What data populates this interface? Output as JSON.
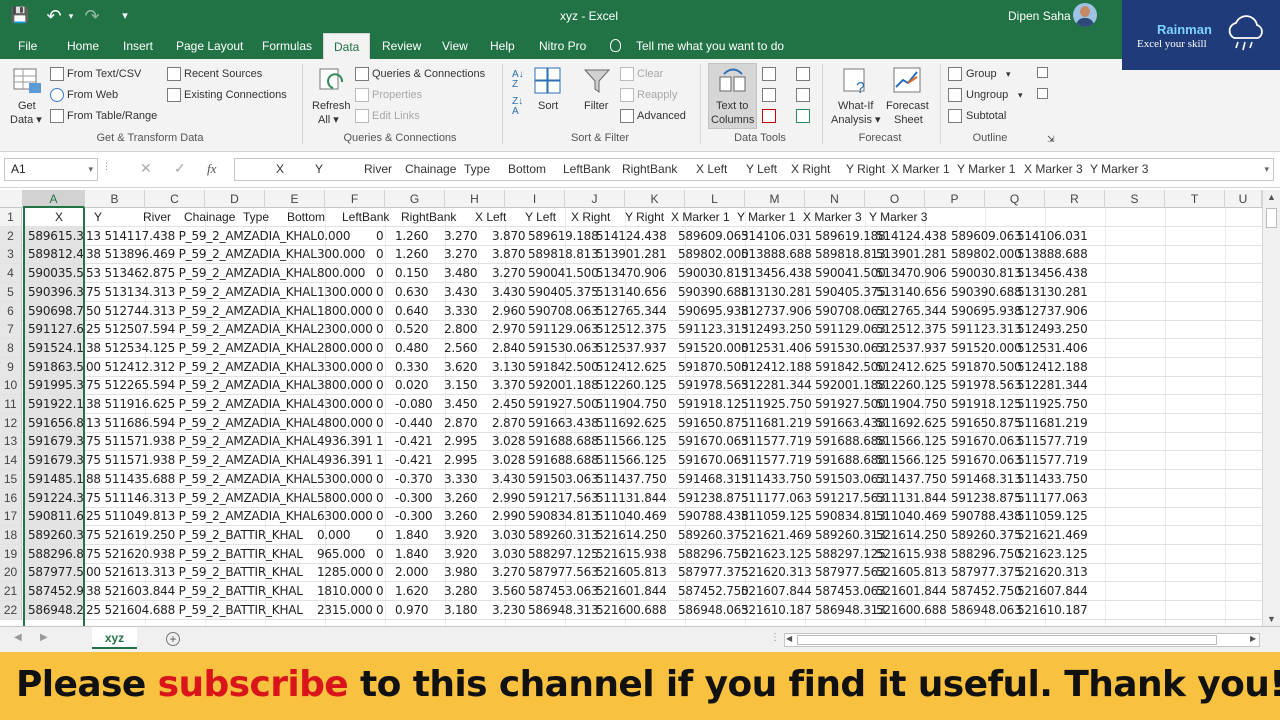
{
  "window": {
    "title": "xyz  -  Excel",
    "user": "Dipen Saha"
  },
  "brand": {
    "name": "Rainman",
    "tagline": "Excel your skill"
  },
  "qat": {
    "save": "💾",
    "undo": "↶",
    "redo": "↷",
    "more": "▾"
  },
  "tabs": [
    "File",
    "Home",
    "Insert",
    "Page Layout",
    "Formulas",
    "Data",
    "Review",
    "View",
    "Help",
    "Nitro Pro"
  ],
  "active_tab": "Data",
  "tell_me": "Tell me what you want to do",
  "ribbon": {
    "get_data": "Get",
    "get_data2": "Data ▾",
    "from_text": "From Text/CSV",
    "from_web": "From Web",
    "from_table": "From Table/Range",
    "recent_sources": "Recent Sources",
    "existing_connections": "Existing Connections",
    "refresh_all": "Refresh",
    "refresh_all2": "All ▾",
    "queries_connections": "Queries & Connections",
    "properties": "Properties",
    "edit_links": "Edit Links",
    "sort": "Sort",
    "filter": "Filter",
    "clear": "Clear",
    "reapply": "Reapply",
    "advanced": "Advanced",
    "text_to_columns": "Text to",
    "text_to_columns2": "Columns",
    "what_if": "What-If",
    "what_if2": "Analysis ▾",
    "forecast_sheet": "Forecast",
    "forecast_sheet2": "Sheet",
    "group": "Group",
    "ungroup": "Ungroup",
    "subtotal": "Subtotal",
    "groups": {
      "get_transform": "Get & Transform Data",
      "queries": "Queries & Connections",
      "sort_filter": "Sort & Filter",
      "data_tools": "Data Tools",
      "forecast": "Forecast",
      "outline": "Outline"
    }
  },
  "formula_bar": {
    "name_box": "A1",
    "fx": "fx",
    "content": [
      "X",
      "Y",
      "River",
      "Chainage",
      "Type",
      "Bottom",
      "LeftBank",
      "RightBank",
      "X Left",
      "Y Left",
      "X Right",
      "Y Right",
      "X Marker 1",
      "Y Marker 1",
      "X Marker 3",
      "Y Marker 3"
    ]
  },
  "columns": [
    "A",
    "B",
    "C",
    "D",
    "E",
    "F",
    "G",
    "H",
    "I",
    "J",
    "K",
    "L",
    "M",
    "N",
    "O",
    "P",
    "Q",
    "R",
    "S",
    "T",
    "U"
  ],
  "sheet": {
    "header_row": [
      "X",
      "Y",
      "River",
      "Chainage",
      "Type",
      "Bottom",
      "LeftBank",
      "RightBank",
      "X Left",
      "Y Left",
      "X Right",
      "Y Right",
      "X Marker 1",
      "Y Marker 1",
      "X Marker 3",
      "Y Marker 3"
    ],
    "rows": [
      {
        "n": "2",
        "a": "589615.3",
        "b": "13 514117.438 P_59_2_AMZADIA_KHAL",
        "c": "0.000",
        "d": "0",
        "e": "1.260",
        "f": "3.270",
        "g": "3.870",
        "h": "589619.188",
        "i": "514124.438",
        "j": "589609.063",
        "k": "514106.031",
        "l": "589619.188",
        "m": "514124.438",
        "o": "589609.063",
        "p": "514106.031"
      },
      {
        "n": "3",
        "a": "589812.4",
        "b": "38 513896.469 P_59_2_AMZADIA_KHAL",
        "c": "300.000",
        "d": "0",
        "e": "1.260",
        "f": "3.270",
        "g": "3.870",
        "h": "589818.813",
        "i": "513901.281",
        "j": "589802.000",
        "k": "513888.688",
        "l": "589818.813",
        "m": "513901.281",
        "o": "589802.000",
        "p": "513888.688"
      },
      {
        "n": "4",
        "a": "590035.5",
        "b": "53 513462.875 P_59_2_AMZADIA_KHAL",
        "c": "800.000",
        "d": "0",
        "e": "0.150",
        "f": "3.480",
        "g": "3.270",
        "h": "590041.500",
        "i": "513470.906",
        "j": "590030.813",
        "k": "513456.438",
        "l": "590041.500",
        "m": "513470.906",
        "o": "590030.813",
        "p": "513456.438"
      },
      {
        "n": "5",
        "a": "590396.3",
        "b": "75 513134.313 P_59_2_AMZADIA_KHAL",
        "c": "1300.000",
        "d": "0",
        "e": "0.630",
        "f": "3.430",
        "g": "3.430",
        "h": "590405.375",
        "i": "513140.656",
        "j": "590390.688",
        "k": "513130.281",
        "l": "590405.375",
        "m": "513140.656",
        "o": "590390.688",
        "p": "513130.281"
      },
      {
        "n": "6",
        "a": "590698.7",
        "b": "50 512744.313 P_59_2_AMZADIA_KHAL",
        "c": "1800.000",
        "d": "0",
        "e": "0.640",
        "f": "3.330",
        "g": "2.960",
        "h": "590708.063",
        "i": "512765.344",
        "j": "590695.938",
        "k": "512737.906",
        "l": "590708.063",
        "m": "512765.344",
        "o": "590695.938",
        "p": "512737.906"
      },
      {
        "n": "7",
        "a": "591127.6",
        "b": "25 512507.594 P_59_2_AMZADIA_KHAL",
        "c": "2300.000",
        "d": "0",
        "e": "0.520",
        "f": "2.800",
        "g": "2.970",
        "h": "591129.063",
        "i": "512512.375",
        "j": "591123.313",
        "k": "512493.250",
        "l": "591129.063",
        "m": "512512.375",
        "o": "591123.313",
        "p": "512493.250"
      },
      {
        "n": "8",
        "a": "591524.1",
        "b": "38 512534.125 P_59_2_AMZADIA_KHAL",
        "c": "2800.000",
        "d": "0",
        "e": "0.480",
        "f": "2.560",
        "g": "2.840",
        "h": "591530.063",
        "i": "512537.937",
        "j": "591520.000",
        "k": "512531.406",
        "l": "591530.063",
        "m": "512537.937",
        "o": "591520.000",
        "p": "512531.406"
      },
      {
        "n": "9",
        "a": "591863.5",
        "b": "00 512412.312 P_59_2_AMZADIA_KHAL",
        "c": "3300.000",
        "d": "0",
        "e": "0.330",
        "f": "3.620",
        "g": "3.130",
        "h": "591842.500",
        "i": "512412.625",
        "j": "591870.500",
        "k": "512412.188",
        "l": "591842.500",
        "m": "512412.625",
        "o": "591870.500",
        "p": "512412.188"
      },
      {
        "n": "10",
        "a": "591995.3",
        "b": "75 512265.594 P_59_2_AMZADIA_KHAL",
        "c": "3800.000",
        "d": "0",
        "e": "0.020",
        "f": "3.150",
        "g": "3.370",
        "h": "592001.188",
        "i": "512260.125",
        "j": "591978.563",
        "k": "512281.344",
        "l": "592001.188",
        "m": "512260.125",
        "o": "591978.563",
        "p": "512281.344"
      },
      {
        "n": "11",
        "a": "591922.1",
        "b": "38 511916.625 P_59_2_AMZADIA_KHAL",
        "c": "4300.000",
        "d": "0",
        "e": "-0.080",
        "f": "3.450",
        "g": "2.450",
        "h": "591927.500",
        "i": "511904.750",
        "j": "591918.125",
        "k": "511925.750",
        "l": "591927.500",
        "m": "511904.750",
        "o": "591918.125",
        "p": "511925.750"
      },
      {
        "n": "12",
        "a": "591656.8",
        "b": "13 511686.594 P_59_2_AMZADIA_KHAL",
        "c": "4800.000",
        "d": "0",
        "e": "-0.440",
        "f": "2.870",
        "g": "2.870",
        "h": "591663.438",
        "i": "511692.625",
        "j": "591650.875",
        "k": "511681.219",
        "l": "591663.438",
        "m": "511692.625",
        "o": "591650.875",
        "p": "511681.219"
      },
      {
        "n": "13",
        "a": "591679.3",
        "b": "75 511571.938 P_59_2_AMZADIA_KHAL",
        "c": "4936.391",
        "d": "1",
        "e": "-0.421",
        "f": "2.995",
        "g": "3.028",
        "h": "591688.688",
        "i": "511566.125",
        "j": "591670.063",
        "k": "511577.719",
        "l": "591688.688",
        "m": "511566.125",
        "o": "591670.063",
        "p": "511577.719"
      },
      {
        "n": "14",
        "a": "591679.3",
        "b": "75 511571.938 P_59_2_AMZADIA_KHAL",
        "c": "4936.391",
        "d": "1",
        "e": "-0.421",
        "f": "2.995",
        "g": "3.028",
        "h": "591688.688",
        "i": "511566.125",
        "j": "591670.063",
        "k": "511577.719",
        "l": "591688.688",
        "m": "511566.125",
        "o": "591670.063",
        "p": "511577.719"
      },
      {
        "n": "15",
        "a": "591485.1",
        "b": "88 511435.688 P_59_2_AMZADIA_KHAL",
        "c": "5300.000",
        "d": "0",
        "e": "-0.370",
        "f": "3.330",
        "g": "3.430",
        "h": "591503.063",
        "i": "511437.750",
        "j": "591468.313",
        "k": "511433.750",
        "l": "591503.063",
        "m": "511437.750",
        "o": "591468.313",
        "p": "511433.750"
      },
      {
        "n": "16",
        "a": "591224.3",
        "b": "75 511146.313 P_59_2_AMZADIA_KHAL",
        "c": "5800.000",
        "d": "0",
        "e": "-0.300",
        "f": "3.260",
        "g": "2.990",
        "h": "591217.563",
        "i": "511131.844",
        "j": "591238.875",
        "k": "511177.063",
        "l": "591217.563",
        "m": "511131.844",
        "o": "591238.875",
        "p": "511177.063"
      },
      {
        "n": "17",
        "a": "590811.6",
        "b": "25 511049.813 P_59_2_AMZADIA_KHAL",
        "c": "6300.000",
        "d": "0",
        "e": "-0.300",
        "f": "3.260",
        "g": "2.990",
        "h": "590834.813",
        "i": "511040.469",
        "j": "590788.438",
        "k": "511059.125",
        "l": "590834.813",
        "m": "511040.469",
        "o": "590788.438",
        "p": "511059.125"
      },
      {
        "n": "18",
        "a": "589260.3",
        "b": "75 521619.250 P_59_2_BATTIR_KHAL",
        "c": "0.000",
        "d": "0",
        "e": "1.840",
        "f": "3.920",
        "g": "3.030",
        "h": "589260.313",
        "i": "521614.250",
        "j": "589260.375",
        "k": "521621.469",
        "l": "589260.313",
        "m": "521614.250",
        "o": "589260.375",
        "p": "521621.469"
      },
      {
        "n": "19",
        "a": "588296.8",
        "b": "75 521620.938 P_59_2_BATTIR_KHAL",
        "c": "965.000",
        "d": "0",
        "e": "1.840",
        "f": "3.920",
        "g": "3.030",
        "h": "588297.125",
        "i": "521615.938",
        "j": "588296.750",
        "k": "521623.125",
        "l": "588297.125",
        "m": "521615.938",
        "o": "588296.750",
        "p": "521623.125"
      },
      {
        "n": "20",
        "a": "587977.5",
        "b": "00 521613.313 P_59_2_BATTIR_KHAL",
        "c": "1285.000",
        "d": "0",
        "e": "2.000",
        "f": "3.980",
        "g": "3.270",
        "h": "587977.563",
        "i": "521605.813",
        "j": "587977.375",
        "k": "521620.313",
        "l": "587977.563",
        "m": "521605.813",
        "o": "587977.375",
        "p": "521620.313"
      },
      {
        "n": "21",
        "a": "587452.9",
        "b": "38 521603.844 P_59_2_BATTIR_KHAL",
        "c": "1810.000",
        "d": "0",
        "e": "1.620",
        "f": "3.280",
        "g": "3.560",
        "h": "587453.063",
        "i": "521601.844",
        "j": "587452.750",
        "k": "521607.844",
        "l": "587453.063",
        "m": "521601.844",
        "o": "587452.750",
        "p": "521607.844"
      },
      {
        "n": "22",
        "a": "586948.2",
        "b": "25 521604.688 P_59_2_BATTIR_KHAL",
        "c": "2315.000",
        "d": "0",
        "e": "0.970",
        "f": "3.180",
        "g": "3.230",
        "h": "586948.313",
        "i": "521600.688",
        "j": "586948.063",
        "k": "521610.187",
        "l": "586948.313",
        "m": "521600.688",
        "o": "586948.063",
        "p": "521610.187"
      }
    ]
  },
  "sheet_tab": "xyz",
  "add_sheet": "+",
  "banner": {
    "part1": "Please ",
    "highlight": "subscribe",
    "part2": " to this channel if you find it useful. Thank you!"
  },
  "colors": {
    "excel_green": "#217346",
    "banner_yellow": "#f8c240",
    "subscribe_red": "#d9151b",
    "brand_blue": "#1f3b7a"
  }
}
